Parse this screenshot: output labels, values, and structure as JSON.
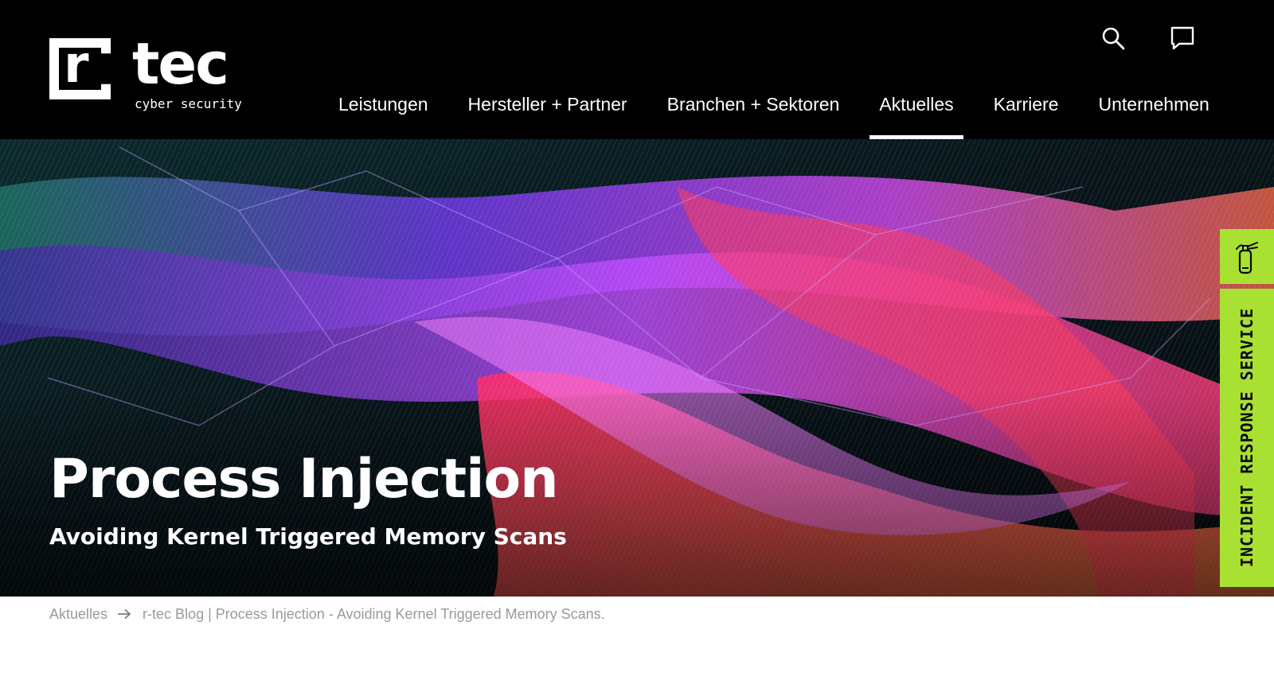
{
  "brand": {
    "logo_letter": "r",
    "logo_word": "tec",
    "tagline": "cyber security",
    "colors": {
      "header_bg": "#000000",
      "accent_green": "#a8e132",
      "text_light": "#ffffff",
      "breadcrumb_text": "#9a9a9a"
    }
  },
  "header": {
    "icons": {
      "search": "search-icon",
      "contact": "chat-bubble-icon"
    },
    "nav": {
      "items": [
        {
          "label": "Leistungen",
          "active": false
        },
        {
          "label": "Hersteller + Partner",
          "active": false
        },
        {
          "label": "Branchen + Sektoren",
          "active": false
        },
        {
          "label": "Aktuelles",
          "active": true
        },
        {
          "label": "Karriere",
          "active": false
        },
        {
          "label": "Unternehmen",
          "active": false
        }
      ]
    }
  },
  "hero": {
    "title": "Process Injection",
    "subtitle": "Avoiding Kernel Triggered Memory Scans"
  },
  "incident_response": {
    "icon": "fire-extinguisher-icon",
    "label": "INCIDENT RESPONSE SERVICE"
  },
  "breadcrumb": {
    "parent": "Aktuelles",
    "separator_icon": "arrow-right-icon",
    "current": "r-tec Blog | Process Injection - Avoiding Kernel Triggered Memory Scans."
  }
}
